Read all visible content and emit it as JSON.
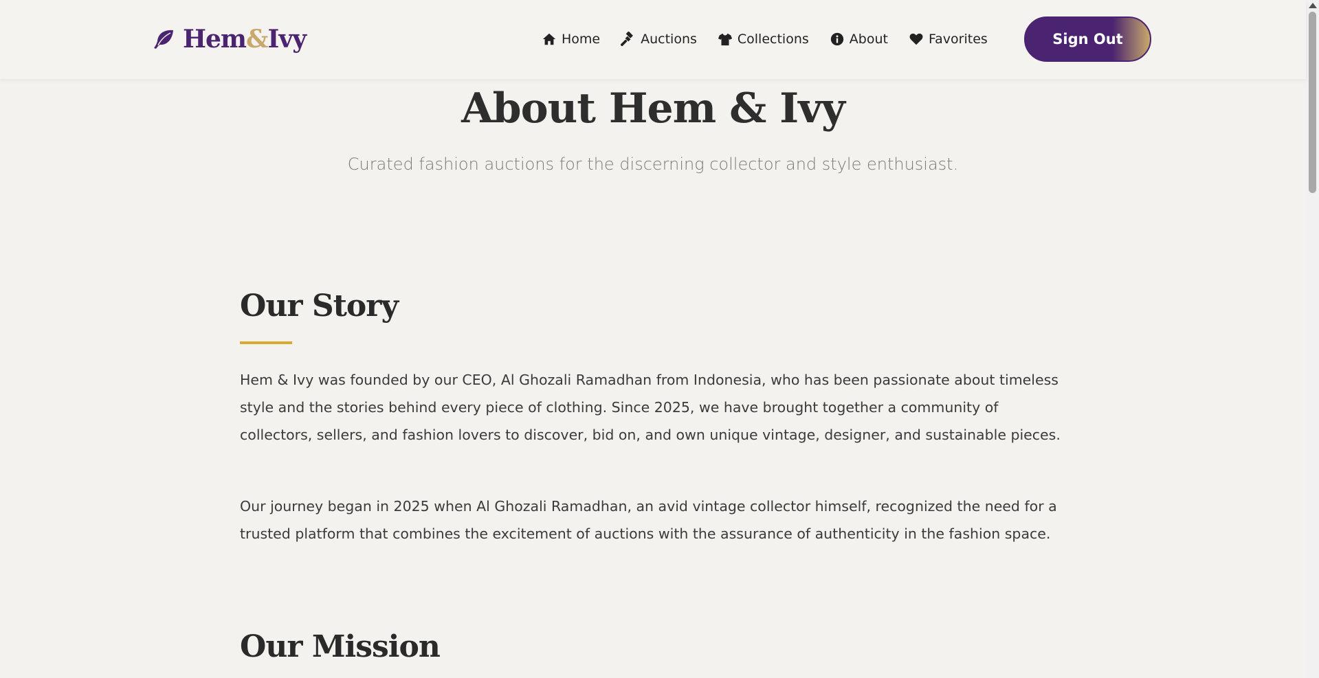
{
  "brand": {
    "name_part1": "Hem",
    "name_amp": "&",
    "name_part2": "Ivy",
    "logo_icon": "leaf-icon",
    "primary_color": "#4a2470",
    "accent_color": "#c8a96b"
  },
  "nav": {
    "items": [
      {
        "label": "Home",
        "icon": "home-icon"
      },
      {
        "label": "Auctions",
        "icon": "gavel-icon"
      },
      {
        "label": "Collections",
        "icon": "shirt-icon"
      },
      {
        "label": "About",
        "icon": "info-icon"
      },
      {
        "label": "Favorites",
        "icon": "heart-icon"
      }
    ],
    "signout_label": "Sign Out"
  },
  "hero": {
    "title": "About Hem & Ivy",
    "subtitle": "Curated fashion auctions for the discerning collector and style enthusiast."
  },
  "story": {
    "title": "Our Story",
    "paragraphs": [
      "Hem & Ivy was founded by our CEO, Al Ghozali Ramadhan from Indonesia, who has been passionate about timeless style and the stories behind every piece of clothing. Since 2025, we have brought together a community of collectors, sellers, and fashion lovers to discover, bid on, and own unique vintage, designer, and sustainable pieces.",
      "Our journey began in 2025 when Al Ghozali Ramadhan, an avid vintage collector himself, recognized the need for a trusted platform that combines the excitement of auctions with the assurance of authenticity in the fashion space."
    ]
  },
  "mission": {
    "title": "Our Mission"
  }
}
